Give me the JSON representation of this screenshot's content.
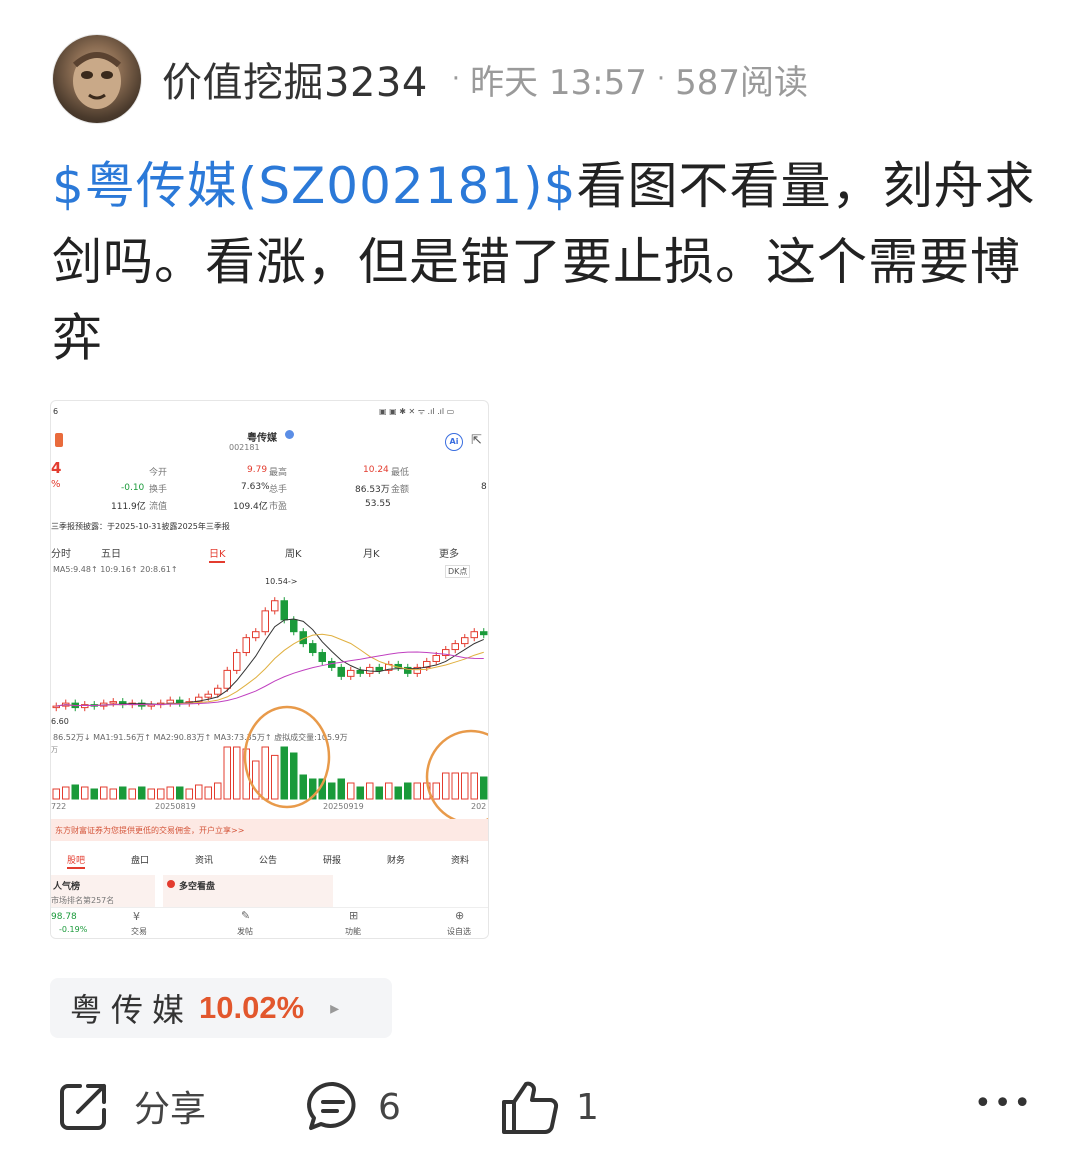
{
  "header": {
    "author": "价值挖掘3234",
    "separator": "·",
    "time": "昨天 13:57",
    "reads": "587阅读"
  },
  "post": {
    "stock_link": "$粤传媒(SZ002181)$",
    "text": "看图不看量，刻舟求剑吗。看涨，但是错了要止损。这个需要博弈"
  },
  "screenshot": {
    "status_left": "6",
    "title": "粤传媒",
    "code": "002181",
    "ai_label": "Ai",
    "price_partial": "4",
    "pct_partial": "%",
    "stats": {
      "today_open_label": "今开",
      "today_open": "9.79",
      "high_label": "最高",
      "high": "10.24",
      "low_label": "最低",
      "change": "-0.10",
      "turnover_label": "换手",
      "turnover": "7.63%",
      "total_mv_label": "总手",
      "total_mv": "86.53万",
      "amount_label": "金额",
      "partial_value": "8",
      "float_mv": "111.9亿",
      "float_label": "流值",
      "mktcap": "109.4亿",
      "mktcap_label": "市盈",
      "pe": "53.55"
    },
    "notice": "三季报预披露：于2025-10-31披露2025年三季报",
    "period_tabs": [
      "分时",
      "五日",
      "日K",
      "周K",
      "月K",
      "更多"
    ],
    "ma_line": "MA5:9.48↑ 10:9.16↑ 20:8.61↑",
    "dk_label": "DK点",
    "peak_label": "10.54->",
    "low_mark": "6.60",
    "vol_line": "86.52万↓  MA1:91.56万↑  MA2:90.83万↑  MA3:73.35万↑  虚拟成交量:105.9万",
    "vol_unit": "万",
    "dates": [
      "722",
      "20250819",
      "20250919",
      "202"
    ],
    "ad_text": "东方财富证券为您提供更低的交易佣金，开户立享>>",
    "bottom_tabs": [
      "股吧",
      "盘口",
      "资讯",
      "公告",
      "研报",
      "财务",
      "资料"
    ],
    "popular_label": "人气榜",
    "rank_text": "市场排名第257名",
    "duokong_label": "多空看盘",
    "index_value": "98.78",
    "index_pct": "-0.19%",
    "nav_items": [
      "交易",
      "发帖",
      "功能",
      "设自选"
    ]
  },
  "chart_data": {
    "type": "candlestick",
    "notes": "Embedded stock daily K-line screenshot; values approximate",
    "candles": [
      {
        "c": 7.0
      },
      {
        "c": 7.1
      },
      {
        "c": 6.95
      },
      {
        "c": 7.05
      },
      {
        "c": 7.0
      },
      {
        "c": 7.1
      },
      {
        "c": 7.15
      },
      {
        "c": 7.05
      },
      {
        "c": 7.1
      },
      {
        "c": 7.0
      },
      {
        "c": 7.05
      },
      {
        "c": 7.1
      },
      {
        "c": 7.2
      },
      {
        "c": 7.1
      },
      {
        "c": 7.15
      },
      {
        "c": 7.3
      },
      {
        "c": 7.4
      },
      {
        "c": 7.6
      },
      {
        "c": 8.2
      },
      {
        "c": 8.8
      },
      {
        "c": 9.3
      },
      {
        "c": 9.5
      },
      {
        "c": 10.2
      },
      {
        "c": 10.54
      },
      {
        "c": 9.9
      },
      {
        "c": 9.5
      },
      {
        "c": 9.1
      },
      {
        "c": 8.8
      },
      {
        "c": 8.5
      },
      {
        "c": 8.3
      },
      {
        "c": 8.0
      },
      {
        "c": 8.2
      },
      {
        "c": 8.1
      },
      {
        "c": 8.3
      },
      {
        "c": 8.2
      },
      {
        "c": 8.4
      },
      {
        "c": 8.3
      },
      {
        "c": 8.1
      },
      {
        "c": 8.3
      },
      {
        "c": 8.5
      },
      {
        "c": 8.7
      },
      {
        "c": 8.9
      },
      {
        "c": 9.1
      },
      {
        "c": 9.3
      },
      {
        "c": 9.5
      },
      {
        "c": 9.4
      }
    ]
  },
  "stock_tag": {
    "name": "粤传媒",
    "change": "10.02%",
    "arrow": "▸"
  },
  "actions": {
    "share_label": "分享",
    "comment_count": "6",
    "like_count": "1",
    "more_label": "•••"
  },
  "colors": {
    "link_blue": "#2b79d8",
    "up_red": "#e33c2f",
    "down_green": "#1a9a3a",
    "tag_orange": "#e2572d"
  }
}
